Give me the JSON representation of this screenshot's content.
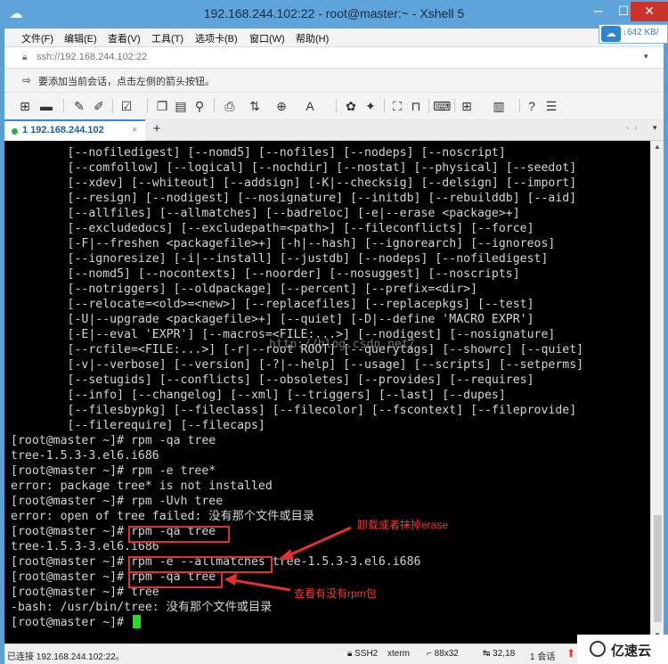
{
  "window": {
    "title": "192.168.244.102:22 - root@master:~ - Xshell 5",
    "minimize_glyph": "─",
    "maximize_glyph": "☐",
    "close_glyph": "✕"
  },
  "menubar": {
    "items": [
      "文件(F)",
      "编辑(E)",
      "查看(V)",
      "工具(T)",
      "选项卡(B)",
      "窗口(W)",
      "帮助(H)"
    ]
  },
  "netspeed": {
    "icon": "cloud-icon",
    "value": "642 KB/"
  },
  "address": {
    "url": "ssh://192.168.244.102:22",
    "dropdown": "▾"
  },
  "hint": {
    "text": "要添加当前会话，点击左侧的箭头按钮。"
  },
  "toolbar": {
    "icons": [
      "new-session-icon",
      "open-folder-icon",
      "connect-icon",
      "disconnect-icon",
      "properties-icon",
      "copy-icon",
      "paste-icon",
      "find-icon",
      "print-icon",
      "transfer-icon",
      "globe-icon",
      "font-icon",
      "xftp-icon",
      "xmanager-icon",
      "fullscreen-icon",
      "lock-icon",
      "keyboard-icon",
      "add-icon",
      "layout-icon",
      "help-icon",
      "chat-icon"
    ]
  },
  "tabs": {
    "items": [
      {
        "label": "1 192.168.244.102",
        "close": "×"
      }
    ],
    "add": "+"
  },
  "terminal": {
    "lines": [
      "        [--nofiledigest] [--nomd5] [--nofiles] [--nodeps] [--noscript]",
      "        [--comfollow] [--logical] [--nochdir] [--nostat] [--physical] [--seedot]",
      "        [--xdev] [--whiteout] [--addsign] [-K|--checksig] [--delsign] [--import]",
      "        [--resign] [--nodigest] [--nosignature] [--initdb] [--rebuilddb] [--aid]",
      "        [--allfiles] [--allmatches] [--badreloc] [-e|--erase <package>+]",
      "        [--excludedocs] [--excludepath=<path>] [--fileconflicts] [--force]",
      "        [-F|--freshen <packagefile>+] [-h|--hash] [--ignorearch] [--ignoreos]",
      "        [--ignoresize] [-i|--install] [--justdb] [--nodeps] [--nofiledigest]",
      "        [--nomd5] [--nocontexts] [--noorder] [--nosuggest] [--noscripts]",
      "        [--notriggers] [--oldpackage] [--percent] [--prefix=<dir>]",
      "        [--relocate=<old>=<new>] [--replacefiles] [--replacepkgs] [--test]",
      "        [-U|--upgrade <packagefile>+] [--quiet] [-D|--define 'MACRO EXPR']",
      "        [-E|--eval 'EXPR'] [--macros=<FILE:...>] [--nodigest] [--nosignature]",
      "        [--rcfile=<FILE:...>] [-r|--root ROOT] [--querytags] [--showrc] [--quiet]",
      "        [-v|--verbose] [--version] [-?|--help] [--usage] [--scripts] [--setperms]",
      "        [--setugids] [--conflicts] [--obsoletes] [--provides] [--requires]",
      "        [--info] [--changelog] [--xml] [--triggers] [--last] [--dupes]",
      "        [--filesbypkg] [--fileclass] [--filecolor] [--fscontext] [--fileprovide]",
      "        [--filerequire] [--filecaps]",
      "[root@master ~]# rpm -qa tree",
      "tree-1.5.3-3.el6.i686",
      "[root@master ~]# rpm -e tree*",
      "error: package tree* is not installed",
      "[root@master ~]# rpm -Uvh tree",
      "error: open of tree failed: 没有那个文件或目录",
      "[root@master ~]# rpm -qa tree",
      "tree-1.5.3-3.el6.i686",
      "[root@master ~]# rpm -e --allmatches tree-1.5.3-3.el6.i686",
      "[root@master ~]# rpm -qa tree",
      "[root@master ~]# tree",
      "-bash: /usr/bin/tree: 没有那个文件或目录",
      "[root@master ~]# "
    ],
    "watermark": "http://blog.csdn.net/"
  },
  "annotations": {
    "erase_note": "卸载或者抹掉erase",
    "query_note": "查看有没有rpm包",
    "color": "#ff3333"
  },
  "statusbar": {
    "connection": "已连接 192.168.244.102:22。",
    "protocol": "SSH2",
    "terminal_type": "xterm",
    "size": "88x32",
    "position": "32,18",
    "sessions": "1 会话"
  },
  "brand": {
    "name": "亿速云"
  }
}
